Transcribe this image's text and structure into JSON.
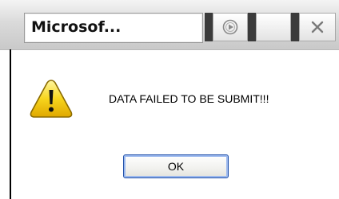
{
  "window": {
    "title": "Microsof...",
    "buttons": {
      "media_icon": "media-play-icon",
      "blank_icon": "blank-button",
      "close_icon": "close-icon"
    }
  },
  "dialog": {
    "icon": "warning-icon",
    "message": "DATA FAILED TO BE SUBMIT!!!",
    "ok_label": "OK"
  },
  "colors": {
    "warning_yellow": "#f7d51d",
    "ok_border": "#1f4fa8"
  }
}
